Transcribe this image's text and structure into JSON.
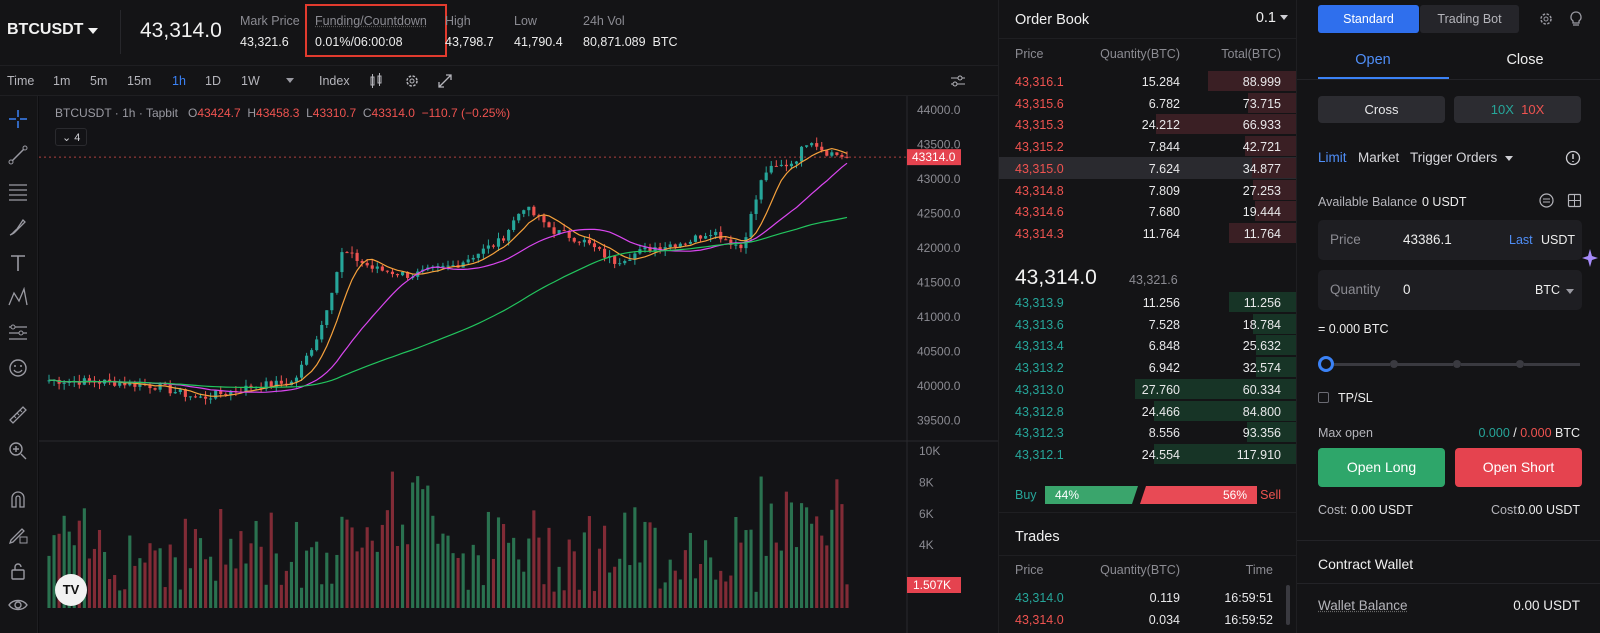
{
  "ticker": {
    "symbol": "BTCUSDT",
    "last_price": "43,314.0",
    "stats": [
      {
        "label": "Mark Price",
        "value": "43,321.6"
      },
      {
        "label": "Funding/Countdown",
        "value": "0.01%/06:00:08"
      },
      {
        "label": "High",
        "value": "43,798.7"
      },
      {
        "label": "Low",
        "value": "41,790.4"
      },
      {
        "label": "24h Vol",
        "value": "80,871.089",
        "unit": "BTC"
      }
    ]
  },
  "toolbar": {
    "intervals": [
      "Time",
      "1m",
      "5m",
      "15m",
      "1h",
      "1D",
      "1W"
    ],
    "active_interval": "1h",
    "index_label": "Index"
  },
  "chart": {
    "pair_label": "BTCUSDT",
    "interval_label": "1h",
    "source_label": "Tapbit",
    "ohlc": {
      "o": "43424.7",
      "h": "43458.3",
      "l": "43310.7",
      "c": "43314.0",
      "change": "−110.7 (−0.25%)"
    },
    "indicator_count": "4",
    "logo_text": "TV",
    "price_axis": [
      "44000.0",
      "43500.0",
      "43000.0",
      "42500.0",
      "42000.0",
      "41500.0",
      "41000.0",
      "40500.0",
      "40000.0",
      "39500.0"
    ],
    "last_price_tag": "43314.0",
    "volume_axis": [
      "10K",
      "8K",
      "6K",
      "4K"
    ],
    "last_volume_tag": "1.507K",
    "colors": {
      "up": "#26a69a",
      "down": "#ef5350",
      "ma_fast": "#f6a13c",
      "ma_mid": "#d946ef",
      "ma_slow": "#22c55e"
    }
  },
  "chart_data": {
    "type": "candlestick",
    "price_range": [
      39200,
      44200
    ],
    "volume_range": [
      0,
      10000
    ],
    "last_price": 43314.0,
    "last_volume": 1507
  },
  "orderbook": {
    "title": "Order Book",
    "precision": "0.1",
    "headers": {
      "price": "Price",
      "qty": "Quantity(BTC)",
      "total": "Total(BTC)"
    },
    "asks": [
      {
        "price": "43,316.1",
        "qty": "15.284",
        "total": "88.999",
        "depth": 0.55
      },
      {
        "price": "43,315.6",
        "qty": "6.782",
        "total": "73.715",
        "depth": 0.3
      },
      {
        "price": "43,315.3",
        "qty": "24.212",
        "total": "66.933",
        "depth": 0.87
      },
      {
        "price": "43,315.2",
        "qty": "7.844",
        "total": "42.721",
        "depth": 0.32
      },
      {
        "price": "43,315.0",
        "qty": "7.624",
        "total": "34.877",
        "depth": 0.28
      },
      {
        "price": "43,314.8",
        "qty": "7.809",
        "total": "27.253",
        "depth": 0.27
      },
      {
        "price": "43,314.6",
        "qty": "7.680",
        "total": "19.444",
        "depth": 0.26
      },
      {
        "price": "43,314.3",
        "qty": "11.764",
        "total": "11.764",
        "depth": 0.42
      }
    ],
    "mid_price": "43,314.0",
    "mark_price": "43,321.6",
    "bids": [
      {
        "price": "43,313.9",
        "qty": "11.256",
        "total": "11.256",
        "depth": 0.42
      },
      {
        "price": "43,313.6",
        "qty": "7.528",
        "total": "18.784",
        "depth": 0.27
      },
      {
        "price": "43,313.4",
        "qty": "6.848",
        "total": "25.632",
        "depth": 0.25
      },
      {
        "price": "43,313.2",
        "qty": "6.942",
        "total": "32.574",
        "depth": 0.25
      },
      {
        "price": "43,313.0",
        "qty": "27.760",
        "total": "60.334",
        "depth": 1.0
      },
      {
        "price": "43,312.8",
        "qty": "24.466",
        "total": "84.800",
        "depth": 0.88
      },
      {
        "price": "43,312.3",
        "qty": "8.556",
        "total": "93.356",
        "depth": 0.31
      },
      {
        "price": "43,312.1",
        "qty": "24.554",
        "total": "117.910",
        "depth": 0.88
      }
    ],
    "buy_label": "Buy",
    "buy_pct": "44%",
    "sell_pct": "56%",
    "sell_label": "Sell",
    "buy_fraction": 0.44
  },
  "trades": {
    "title": "Trades",
    "headers": {
      "price": "Price",
      "qty": "Quantity(BTC)",
      "time": "Time"
    },
    "rows": [
      {
        "price": "43,314.0",
        "qty": "0.119",
        "time": "16:59:51",
        "side": "buy"
      },
      {
        "price": "43,314.0",
        "qty": "0.034",
        "time": "16:59:52",
        "side": "sell"
      }
    ]
  },
  "trade_panel": {
    "mode_tabs": [
      "Standard",
      "Trading Bot"
    ],
    "action_tabs": [
      "Open",
      "Close"
    ],
    "margin_mode": "Cross",
    "leverage_long": "10X",
    "leverage_short": "10X",
    "order_types": [
      "Limit",
      "Market",
      "Trigger Orders"
    ],
    "available_label": "Available Balance",
    "available_value": "0 USDT",
    "price_label": "Price",
    "price_value": "43386.1",
    "price_last": "Last",
    "price_unit": "USDT",
    "qty_label": "Quantity",
    "qty_value": "0",
    "qty_unit": "BTC",
    "equiv": "= 0.000 BTC",
    "slider_fraction": 0.0,
    "tpsl_label": "TP/SL",
    "max_open_label": "Max open",
    "max_open_long": "0.000",
    "max_open_sep": "/",
    "max_open_short": "0.000",
    "max_open_unit": "BTC",
    "open_long": "Open Long",
    "open_short": "Open Short",
    "cost_label": "Cost:",
    "cost_long": "0.00 USDT",
    "cost_short": "0.00 USDT",
    "wallet_title": "Contract Wallet",
    "wallet_balance_label": "Wallet Balance",
    "wallet_balance_value": "0.00 USDT"
  }
}
